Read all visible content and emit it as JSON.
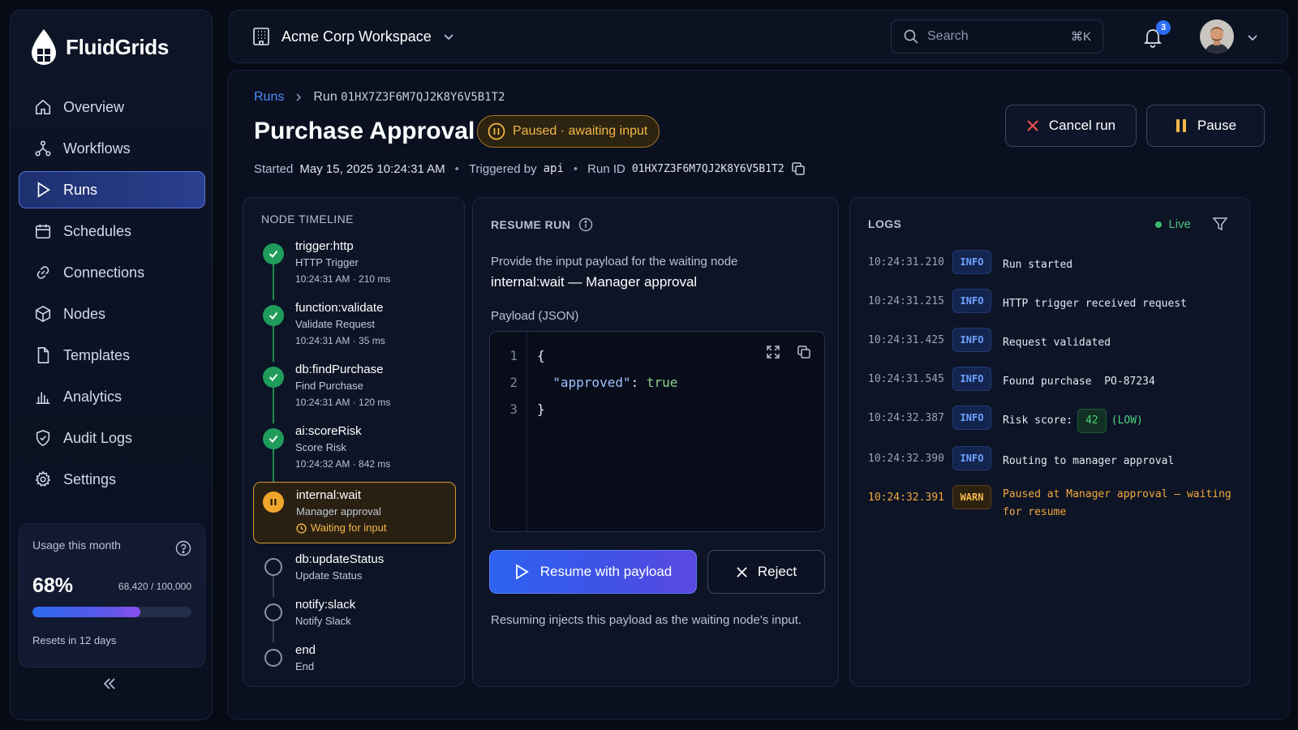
{
  "brand": {
    "name": "FluidGrids"
  },
  "sidebar": {
    "items": [
      {
        "label": "Overview",
        "icon": "home-icon"
      },
      {
        "label": "Workflows",
        "icon": "workflow-icon"
      },
      {
        "label": "Runs",
        "icon": "play-icon",
        "active": true
      },
      {
        "label": "Schedules",
        "icon": "calendar-icon"
      },
      {
        "label": "Connections",
        "icon": "link-icon"
      },
      {
        "label": "Nodes",
        "icon": "cube-icon"
      },
      {
        "label": "Templates",
        "icon": "file-icon"
      },
      {
        "label": "Analytics",
        "icon": "bar-chart-icon"
      },
      {
        "label": "Audit Logs",
        "icon": "shield-icon"
      },
      {
        "label": "Settings",
        "icon": "gear-icon"
      }
    ],
    "usage": {
      "title": "Usage this month",
      "percent_label": "68%",
      "percent": 0.68,
      "count": "68,420 / 100,000",
      "reset": "Resets in 12 days"
    }
  },
  "topbar": {
    "workspace": "Acme Corp Workspace",
    "search_placeholder": "Search",
    "search_shortcut": "⌘K",
    "notifications_count": "3"
  },
  "run": {
    "breadcrumb_root": "Runs",
    "breadcrumb_prefix": "Run",
    "breadcrumb_id": "01HX7Z3F6M7QJ2K8Y6V5B1T2",
    "title": "Purchase Approval",
    "status": "Paused · awaiting input",
    "started_label": "Started",
    "started_value": "May 15, 2025 10:24:31 AM",
    "triggered_label": "Triggered by",
    "triggered_value": "api",
    "run_id_label": "Run ID",
    "run_id_value": "01HX7Z3F6M7QJ2K8Y6V5B1T2",
    "cancel_label": "Cancel run",
    "pause_label": "Pause",
    "accent_color": "#f5b94a"
  },
  "timeline": {
    "title": "NODE TIMELINE",
    "nodes": [
      {
        "name": "trigger:http",
        "sub": "HTTP Trigger",
        "time": "10:24:31 AM · 210 ms",
        "state": "done"
      },
      {
        "name": "function:validate",
        "sub": "Validate Request",
        "time": "10:24:31 AM · 35 ms",
        "state": "done"
      },
      {
        "name": "db:findPurchase",
        "sub": "Find Purchase",
        "time": "10:24:31 AM · 120 ms",
        "state": "done"
      },
      {
        "name": "ai:scoreRisk",
        "sub": "Score Risk",
        "time": "10:24:32 AM · 842 ms",
        "state": "done"
      },
      {
        "name": "internal:wait",
        "sub": "Manager approval",
        "time": "Waiting for input",
        "state": "waiting"
      },
      {
        "name": "db:updateStatus",
        "sub": "Update Status",
        "state": "pending"
      },
      {
        "name": "notify:slack",
        "sub": "Notify Slack",
        "state": "pending"
      },
      {
        "name": "end",
        "sub": "End",
        "state": "pending"
      }
    ]
  },
  "resume": {
    "title": "RESUME RUN",
    "description": "Provide the input payload for the waiting node",
    "target": "internal:wait — Manager approval",
    "payload_label": "Payload (JSON)",
    "code_lines": [
      "1",
      "2",
      "3"
    ],
    "code_open": "{",
    "code_key": "\"approved\"",
    "code_colon": ": ",
    "code_value": "true",
    "code_close": "}",
    "resume_label": "Resume with payload",
    "reject_label": "Reject",
    "note": "Resuming injects this payload as the waiting node's input."
  },
  "logs": {
    "title": "LOGS",
    "live_label": "Live",
    "entries": [
      {
        "time": "10:24:31.210",
        "level": "INFO",
        "message": "Run started"
      },
      {
        "time": "10:24:31.215",
        "level": "INFO",
        "message": "HTTP trigger received request"
      },
      {
        "time": "10:24:31.425",
        "level": "INFO",
        "message": "Request validated"
      },
      {
        "time": "10:24:31.545",
        "level": "INFO",
        "message": "Found purchase  PO-87234"
      },
      {
        "time": "10:24:32.387",
        "level": "INFO",
        "message": "Risk score:",
        "score": "42",
        "score_note": "(LOW)"
      },
      {
        "time": "10:24:32.390",
        "level": "INFO",
        "message": "Routing to manager approval"
      },
      {
        "time": "10:24:32.391",
        "level": "WARN",
        "message": "Paused at Manager approval – waiting for resume"
      }
    ]
  }
}
